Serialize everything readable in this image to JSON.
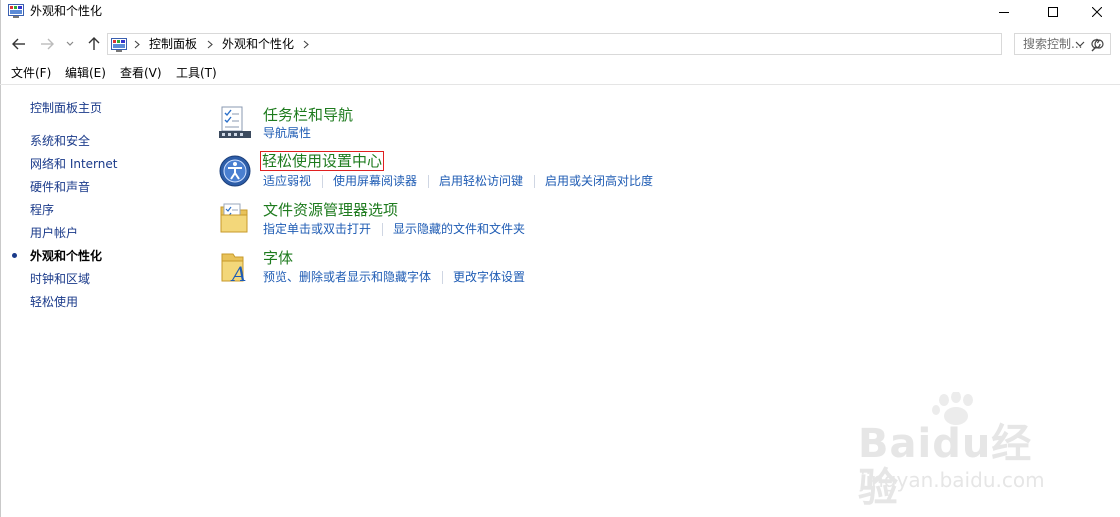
{
  "window": {
    "title": "外观和个性化"
  },
  "address": {
    "crumbs": [
      "控制面板",
      "外观和个性化"
    ],
    "search_placeholder": "搜索控制..."
  },
  "menu": [
    "文件(F)",
    "编辑(E)",
    "查看(V)",
    "工具(T)"
  ],
  "sidebar": {
    "home": "控制面板主页",
    "items": [
      {
        "label": "系统和安全"
      },
      {
        "label": "网络和 Internet"
      },
      {
        "label": "硬件和声音"
      },
      {
        "label": "程序"
      },
      {
        "label": "用户帐户"
      },
      {
        "label": "外观和个性化",
        "current": true
      },
      {
        "label": "时钟和区域"
      },
      {
        "label": "轻松使用"
      }
    ]
  },
  "categories": [
    {
      "title": "任务栏和导航",
      "icon": "taskbar-icon",
      "links": [
        "导航属性"
      ]
    },
    {
      "title": "轻松使用设置中心",
      "icon": "ease-of-access-icon",
      "highlighted": true,
      "links": [
        "适应弱视",
        "使用屏幕阅读器",
        "启用轻松访问键",
        "启用或关闭高对比度"
      ]
    },
    {
      "title": "文件资源管理器选项",
      "icon": "folder-options-icon",
      "links": [
        "指定单击或双击打开",
        "显示隐藏的文件和文件夹"
      ]
    },
    {
      "title": "字体",
      "icon": "fonts-icon",
      "links": [
        "预览、删除或者显示和隐藏字体",
        "更改字体设置"
      ]
    }
  ],
  "watermark": {
    "brand": "Baidu经验",
    "url": "jingyan.baidu.com"
  },
  "colors": {
    "category_title": "#1e7b1e",
    "link": "#1f5cb4",
    "highlight_box": "#e02020"
  }
}
